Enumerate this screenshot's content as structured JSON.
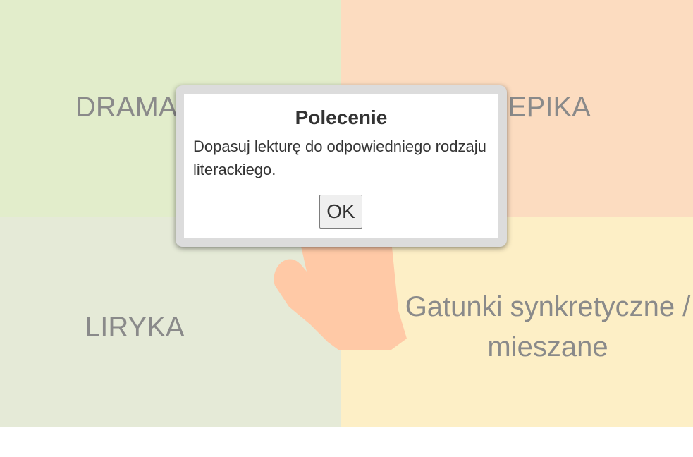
{
  "board": {
    "quadrants": {
      "drama": {
        "label": "DRAMAT"
      },
      "epika": {
        "label": "EPIKA"
      },
      "liryka": {
        "label": "LIRYKA"
      },
      "gatunki": {
        "label": "Gatunki synkretyczne / mieszane"
      }
    },
    "colors": {
      "drama": "#e2edcb",
      "epika": "#fcdcc0",
      "liryka": "#e5ead7",
      "gatunki": "#fdefc6",
      "hand": "#ffc9a6"
    },
    "hand_icon": "pointing-hand-icon"
  },
  "modal": {
    "title": "Polecenie",
    "text": "Dopasuj lekturę do odpowiedniego rodzaju literackiego.",
    "ok_label": "OK"
  }
}
